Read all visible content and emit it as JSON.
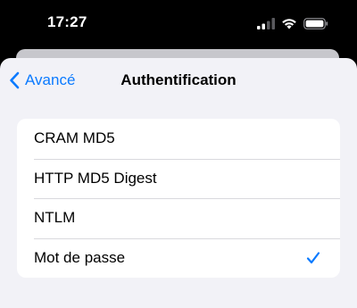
{
  "status_bar": {
    "time": "17:27",
    "icons": [
      "cellular-signal-icon",
      "wifi-icon",
      "battery-icon"
    ]
  },
  "nav": {
    "back_label": "Avancé",
    "back_icon": "chevron-left-icon",
    "title": "Authentification"
  },
  "options": [
    {
      "label": "CRAM MD5",
      "selected": false
    },
    {
      "label": "HTTP MD5 Digest",
      "selected": false
    },
    {
      "label": "NTLM",
      "selected": false
    },
    {
      "label": "Mot de passe",
      "selected": true
    }
  ],
  "colors": {
    "accent": "#0a7aff",
    "background": "#f2f2f7",
    "status_bar_bg": "#000000"
  }
}
